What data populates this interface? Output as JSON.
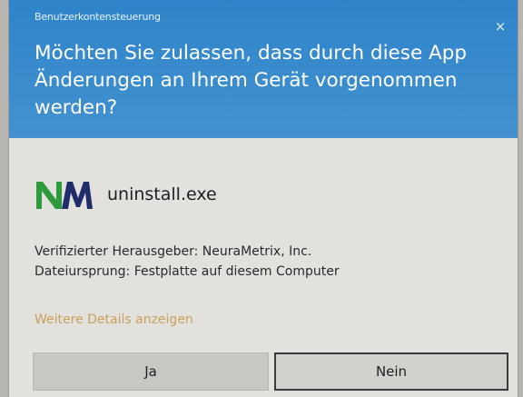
{
  "window": {
    "title": "Benutzerkontensteuerung",
    "close_glyph": "×"
  },
  "prompt": {
    "question": "Möchten Sie zulassen, dass durch diese App Änderungen an Ihrem Gerät vorgenommen werden?"
  },
  "app": {
    "logo_icon": "neurametrix-nm-logo-icon",
    "logo_text": "NM",
    "name": "uninstall.exe",
    "publisher_line": "Verifizierter Herausgeber: NeuraMetrix, Inc.",
    "origin_line": "Dateiursprung: Festplatte auf diesem Computer"
  },
  "links": {
    "more_details": "Weitere Details anzeigen"
  },
  "buttons": {
    "yes": "Ja",
    "no": "Nein"
  },
  "colors": {
    "header_blue": "#3586c8",
    "body_bg": "#e3e1dd",
    "link": "#c8a15c",
    "logo_green": "#2e9a3e",
    "logo_navy": "#1f2d6b"
  }
}
